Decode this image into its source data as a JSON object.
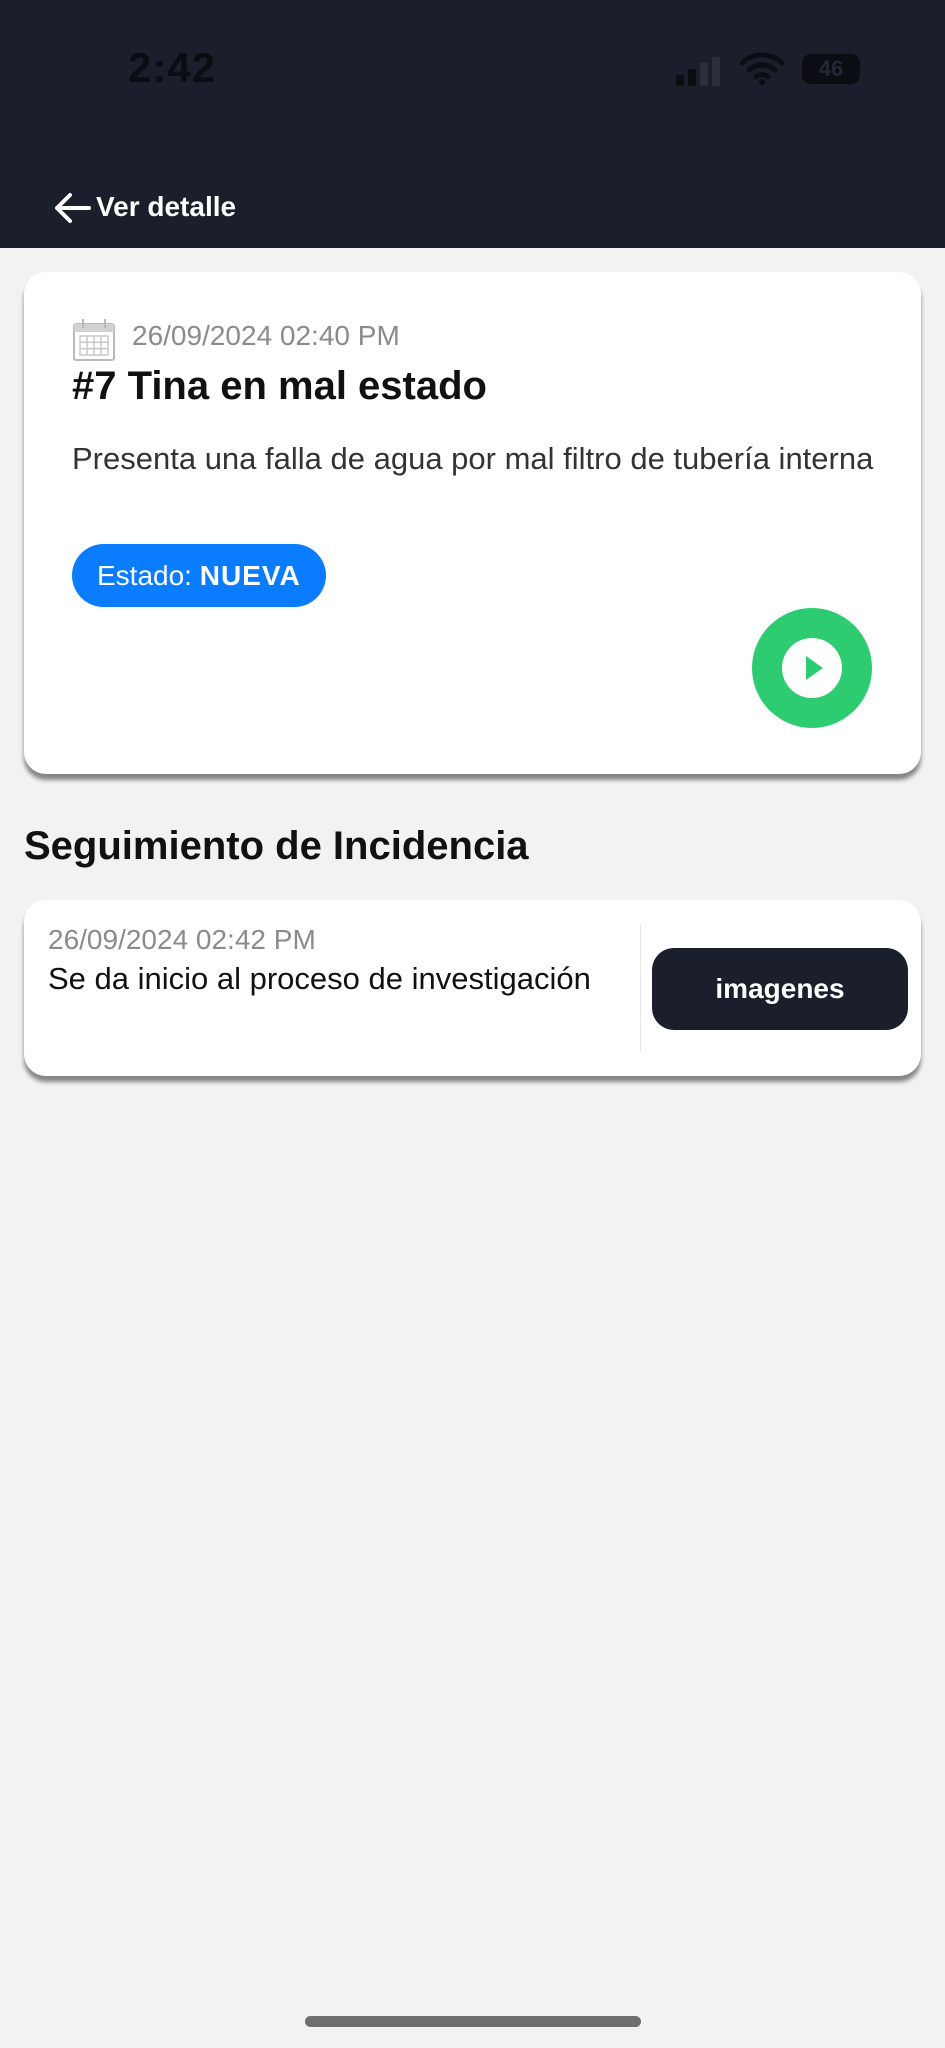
{
  "status_bar": {
    "time": "2:42",
    "battery": "46",
    "icons": [
      "signal-icon",
      "wifi-icon",
      "battery-icon"
    ]
  },
  "nav": {
    "back_icon": "arrow-left-icon",
    "title": "Ver detalle"
  },
  "incident": {
    "calendar_icon": "calendar-icon",
    "date": "26/09/2024 02:40 PM",
    "title": "#7 Tina en mal estado",
    "description": "Presenta una falla de agua por mal filtro de tubería interna",
    "status_label": "Estado:",
    "status_value": "NUEVA",
    "status_color": "#0a7cff",
    "action_icon": "play-icon",
    "action_color": "#2ecc71"
  },
  "tracking": {
    "section_title": "Seguimiento de Incidencia",
    "entries": [
      {
        "date": "26/09/2024 02:42 PM",
        "text": "Se da inicio al proceso de investigación",
        "button_label": "imagenes"
      }
    ]
  },
  "colors": {
    "header_bg": "#1a1f2b",
    "page_bg": "#f2f2f2",
    "card_bg": "#ffffff"
  }
}
